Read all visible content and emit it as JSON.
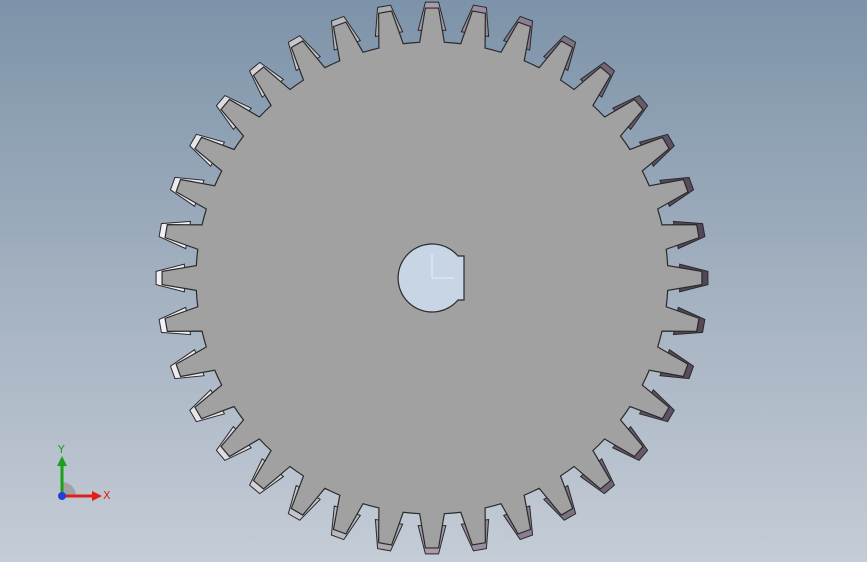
{
  "viewport": {
    "background_top": "#7d93a9",
    "background_bottom": "#c4ccd6"
  },
  "gear": {
    "tooth_count": 36,
    "face_color": "#a1a1a1",
    "edge_color": "#2a2a2a",
    "tooth_side_light": "#f4f4f4",
    "tooth_side_dark": "#555058",
    "bore_color": "#c7d5e4",
    "has_keyway": true
  },
  "triad": {
    "x_label": "X",
    "y_label": "Y",
    "x_color": "#e0201a",
    "y_color": "#1aa01a",
    "z_color": "#2040d8"
  }
}
